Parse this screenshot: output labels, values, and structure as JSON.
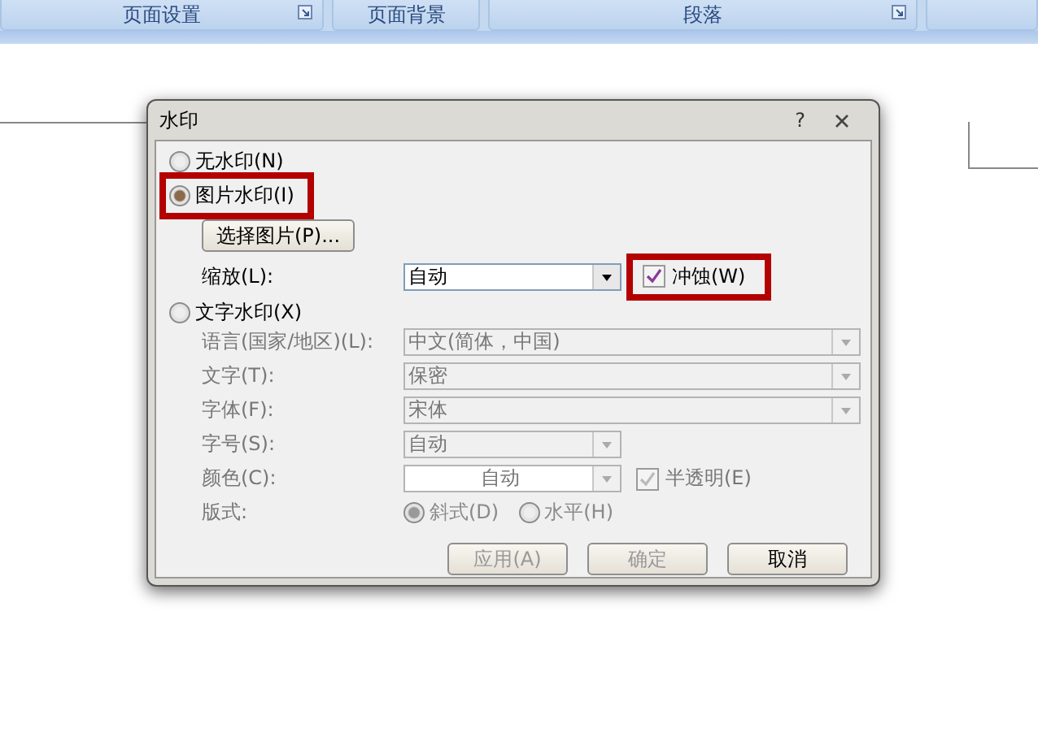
{
  "ribbon": {
    "groups": [
      {
        "label": "页面设置",
        "launcher": true
      },
      {
        "label": "页面背景",
        "launcher": false
      },
      {
        "label": "段落",
        "launcher": true
      }
    ]
  },
  "dialog": {
    "title": "水印",
    "help": "?",
    "no_watermark": {
      "label": "无水印(N)",
      "selected": false,
      "highlighted": false
    },
    "picture_watermark": {
      "label": "图片水印(I)",
      "selected": true,
      "highlighted": true
    },
    "select_picture_button": "选择图片(P)...",
    "scale": {
      "label": "缩放(L):",
      "value": "自动"
    },
    "washout": {
      "label": "冲蚀(W)",
      "checked": true,
      "highlighted": true
    },
    "text_watermark": {
      "label": "文字水印(X)",
      "selected": false,
      "highlighted": false
    },
    "text_fields": [
      {
        "label": "语言(国家/地区)(L):",
        "value": "中文(简体，中国)",
        "kind": "wide",
        "disabled": true
      },
      {
        "label": "文字(T):",
        "value": "保密",
        "kind": "wide",
        "disabled": true
      },
      {
        "label": "字体(F):",
        "value": "宋体",
        "kind": "wide",
        "disabled": true
      },
      {
        "label": "字号(S):",
        "value": "自动",
        "kind": "narrow",
        "disabled": true
      },
      {
        "label": "颜色(C):",
        "value": "自动",
        "kind": "color",
        "disabled": true,
        "checkbox": {
          "label": "半透明(E)",
          "checked": true,
          "disabled": true
        }
      }
    ],
    "layout": {
      "label": "版式:",
      "options": [
        {
          "label": "斜式(D)",
          "selected": true
        },
        {
          "label": "水平(H)",
          "selected": false
        }
      ]
    },
    "buttons": [
      {
        "label": "应用(A)",
        "disabled": true
      },
      {
        "label": "确定",
        "disabled": true
      },
      {
        "label": "取消",
        "disabled": false
      }
    ]
  }
}
